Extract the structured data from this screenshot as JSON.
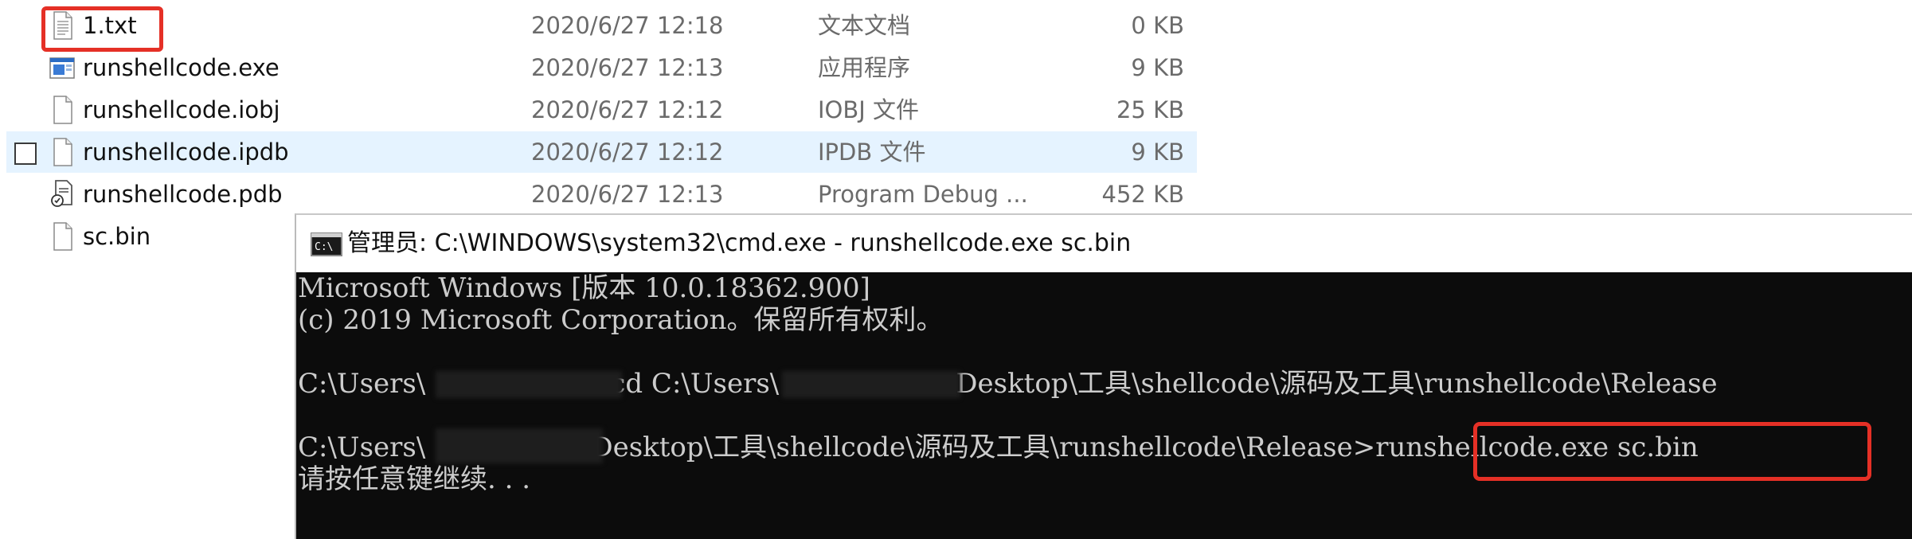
{
  "explorer": {
    "files": [
      {
        "name": "1.txt",
        "date": "2020/6/27 12:18",
        "type": "文本文档",
        "size": "0 KB",
        "icon": "text-document-icon"
      },
      {
        "name": "runshellcode.exe",
        "date": "2020/6/27 12:13",
        "type": "应用程序",
        "size": "9 KB",
        "icon": "application-icon"
      },
      {
        "name": "runshellcode.iobj",
        "date": "2020/6/27 12:12",
        "type": "IOBJ 文件",
        "size": "25 KB",
        "icon": "blank-file-icon"
      },
      {
        "name": "runshellcode.ipdb",
        "date": "2020/6/27 12:12",
        "type": "IPDB 文件",
        "size": "9 KB",
        "icon": "blank-file-icon"
      },
      {
        "name": "runshellcode.pdb",
        "date": "2020/6/27 12:13",
        "type": "Program Debug ...",
        "size": "452 KB",
        "icon": "debug-database-icon"
      },
      {
        "name": "sc.bin",
        "date": "",
        "type": "",
        "size": "",
        "icon": "blank-file-icon"
      }
    ],
    "hovered_row": "runshellcode.ipdb"
  },
  "cmd": {
    "title": "管理员: C:\\WINDOWS\\system32\\cmd.exe - runshellcode.exe  sc.bin",
    "lines": {
      "l1": "Microsoft Windows [版本 10.0.18362.900]",
      "l2": "(c) 2019 Microsoft Corporation。保留所有权利。",
      "l3a": "C:\\Users\\",
      "l3b": "cd C:\\Users\\",
      "l3c": "Desktop\\工具\\shellcode\\源码及工具\\runshellcode\\Release",
      "l4a": "C:\\Users\\",
      "l4b": "Desktop\\工具\\shellcode\\源码及工具\\runshellcode\\Release>",
      "l4c": "runshellcode.exe sc.bin",
      "l5": "请按任意键继续. . ."
    }
  },
  "colors": {
    "highlight": "#e53026",
    "console_bg": "#0c0c0c",
    "console_text": "#cccccc",
    "selection": "#e5f3ff"
  }
}
